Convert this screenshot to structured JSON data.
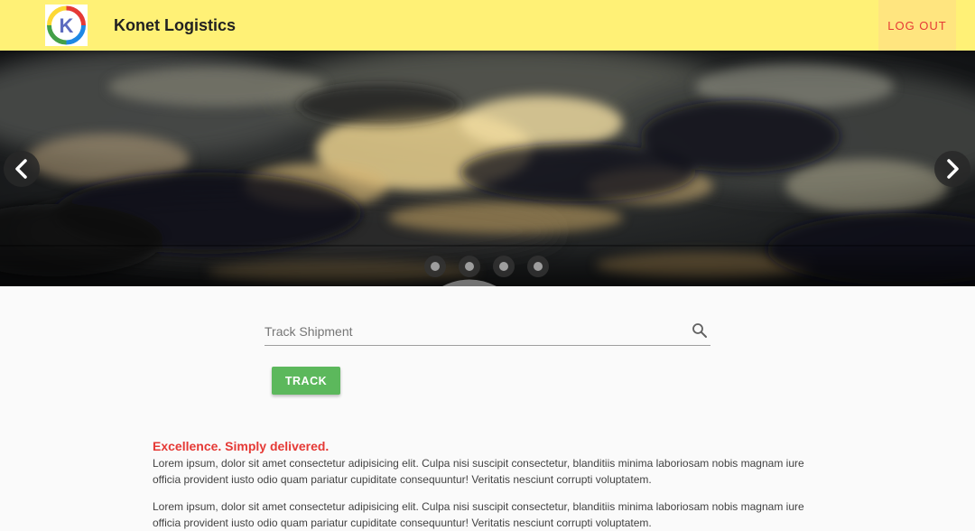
{
  "header": {
    "brand": "Konet Logistics",
    "logout_label": "LOG OUT",
    "logo_letter": "K",
    "background_color": "#fff176"
  },
  "carousel": {
    "prev_icon": "chevron-left-icon",
    "next_icon": "chevron-right-icon",
    "slide_count": 4,
    "active_index": 0
  },
  "search": {
    "placeholder": "Track Shipment",
    "value": "",
    "icon": "search-icon"
  },
  "track_button": {
    "label": "TRACK",
    "color": "#5cb85c"
  },
  "content": {
    "headline": "Excellence. Simply delivered.",
    "headline_color": "#e53935",
    "paragraphs": [
      "Lorem ipsum, dolor sit amet consectetur adipisicing elit. Culpa nisi suscipit consectetur, blanditiis minima laboriosam nobis magnam iure officia provident iusto odio quam pariatur cupiditate consequuntur! Veritatis nesciunt corrupti voluptatem.",
      "Lorem ipsum, dolor sit amet consectetur adipisicing elit. Culpa nisi suscipit consectetur, blanditiis minima laboriosam nobis magnam iure officia provident iusto odio quam pariatur cupiditate consequuntur! Veritatis nesciunt corrupti voluptatem."
    ]
  }
}
